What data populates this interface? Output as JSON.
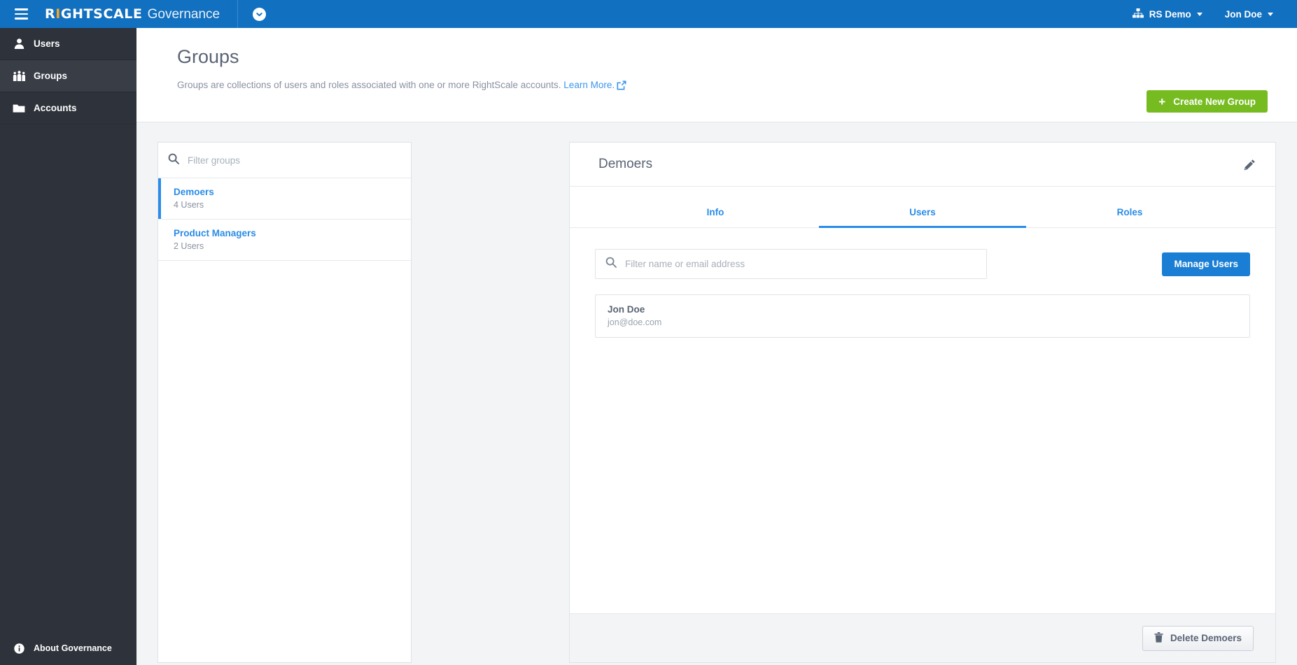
{
  "topbar": {
    "menu_icon": "hamburger-icon",
    "brand_name": "RIGHTSCALE",
    "brand_product": "Governance",
    "account_switcher_icon": "chevron-down-circle-icon",
    "account": {
      "icon": "org-chart-icon",
      "label": "RS Demo"
    },
    "user": {
      "label": "Jon Doe"
    }
  },
  "sidebar": {
    "items": [
      {
        "label": "Users",
        "icon": "user-icon",
        "active": false
      },
      {
        "label": "Groups",
        "icon": "people-group-icon",
        "active": true
      },
      {
        "label": "Accounts",
        "icon": "folder-icon",
        "active": false
      }
    ],
    "footer": {
      "label": "About Governance",
      "icon": "info-icon"
    }
  },
  "page": {
    "title": "Groups",
    "subtitle": "Groups are collections of users and roles associated with one or more RightScale accounts.",
    "learn_more": "Learn More.",
    "learn_more_icon": "external-link-icon",
    "create_button": {
      "label": "Create New Group",
      "icon": "plus-icon"
    }
  },
  "groups_panel": {
    "filter": {
      "placeholder": "Filter groups",
      "value": "",
      "icon": "search-icon"
    },
    "items": [
      {
        "name": "Demoers",
        "count": "4 Users",
        "selected": true
      },
      {
        "name": "Product Managers",
        "count": "2 Users",
        "selected": false
      }
    ]
  },
  "detail": {
    "title": "Demoers",
    "edit_icon": "pencil-icon",
    "tabs": [
      {
        "label": "Info",
        "active": false
      },
      {
        "label": "Users",
        "active": true
      },
      {
        "label": "Roles",
        "active": false
      }
    ],
    "user_filter": {
      "placeholder": "Filter name or email address",
      "value": "",
      "icon": "search-icon"
    },
    "manage_button": {
      "label": "Manage Users"
    },
    "users": [
      {
        "name": "Jon Doe",
        "email": "jon@doe.com"
      }
    ],
    "delete_button": {
      "label": "Delete Demoers",
      "icon": "trash-icon"
    }
  },
  "colors": {
    "brand_blue": "#1270c0",
    "accent_blue": "#2a8ce8",
    "green": "#76bc21",
    "sidebar_dark": "#2e333b"
  }
}
